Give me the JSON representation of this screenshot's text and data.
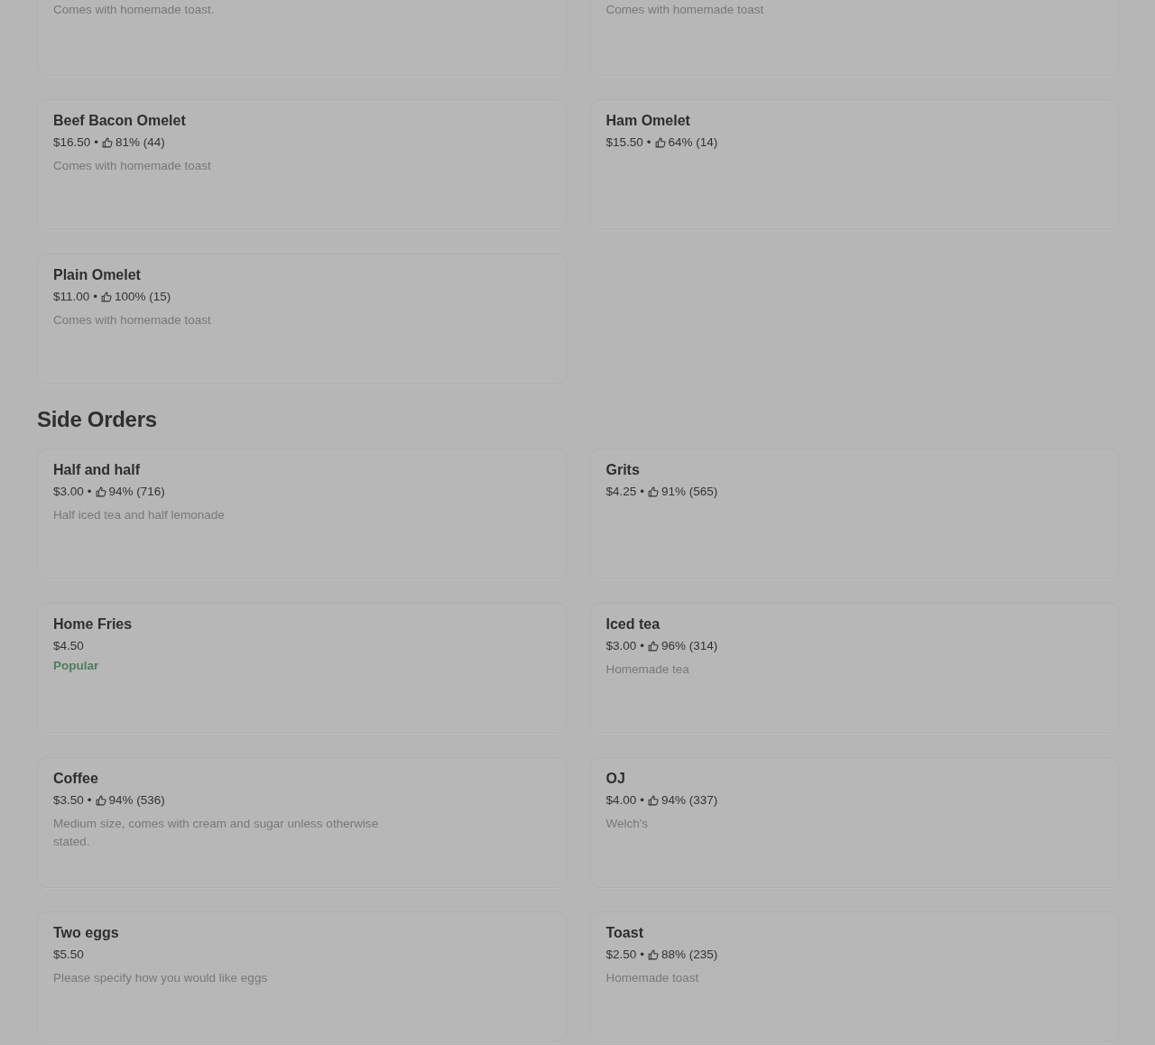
{
  "sections": [
    {
      "items": [
        {
          "kind": "clipped",
          "description": "Comes with homemade toast."
        },
        {
          "kind": "clipped",
          "description": "Comes with homemade toast"
        },
        {
          "kind": "full",
          "name": "Beef Bacon Omelet",
          "price": "$16.50",
          "separator": "•",
          "rating": "81% (44)",
          "description": "Comes with homemade toast"
        },
        {
          "kind": "full",
          "name": "Ham Omelet",
          "price": "$15.50",
          "separator": "•",
          "rating": "64% (14)"
        },
        {
          "kind": "full",
          "name": "Plain Omelet",
          "price": "$11.00",
          "separator": "•",
          "rating": "100% (15)",
          "description": "Comes with homemade toast"
        }
      ]
    },
    {
      "title": "Side Orders",
      "items": [
        {
          "kind": "full",
          "name": "Half and half",
          "price": "$3.00",
          "separator": "•",
          "rating": "94% (716)",
          "description": "Half iced tea and half lemonade"
        },
        {
          "kind": "full",
          "name": "Grits",
          "price": "$4.25",
          "separator": "•",
          "rating": "91% (565)"
        },
        {
          "kind": "full",
          "name": "Home Fries",
          "price": "$4.50",
          "tag": "Popular"
        },
        {
          "kind": "full",
          "name": "Iced tea",
          "price": "$3.00",
          "separator": "•",
          "rating": "96% (314)",
          "description": "Homemade tea"
        },
        {
          "kind": "full",
          "name": "Coffee",
          "price": "$3.50",
          "separator": "•",
          "rating": "94% (536)",
          "description": "Medium size, comes with cream and sugar unless otherwise stated."
        },
        {
          "kind": "full",
          "name": "OJ",
          "price": "$4.00",
          "separator": "•",
          "rating": "94% (337)",
          "description": "Welch's"
        },
        {
          "kind": "full",
          "name": "Two eggs",
          "price": "$5.50",
          "description": "Please specify how you would like eggs"
        },
        {
          "kind": "full",
          "name": "Toast",
          "price": "$2.50",
          "separator": "•",
          "rating": "88% (235)",
          "description": "Homemade toast"
        }
      ]
    }
  ]
}
